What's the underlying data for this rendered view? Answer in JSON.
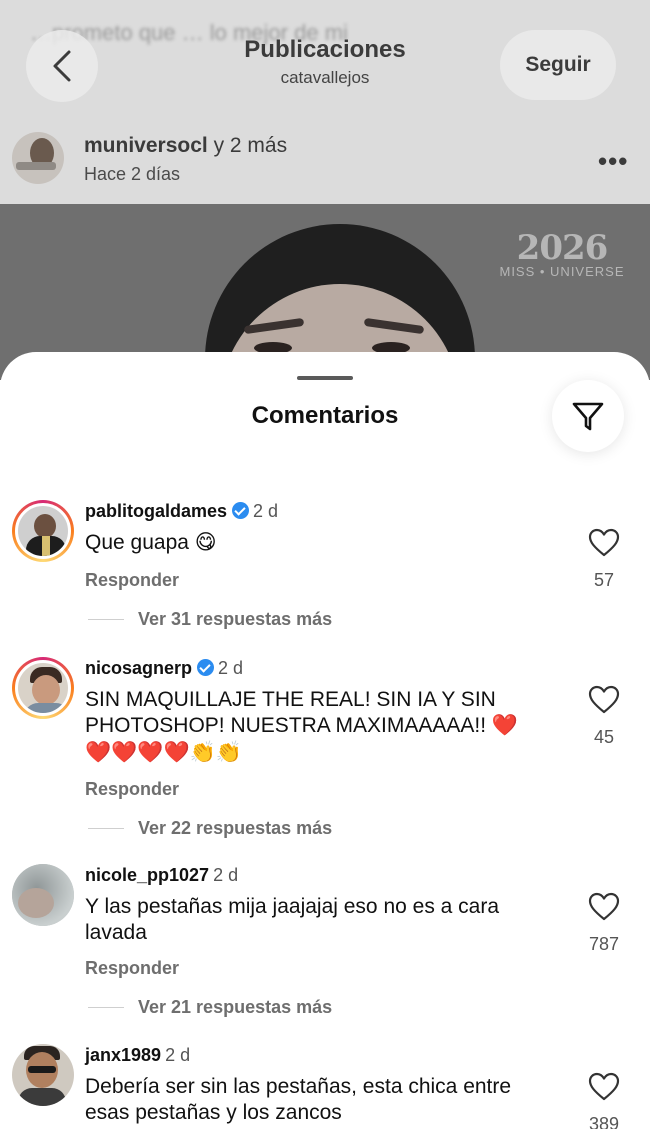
{
  "background": {
    "caption_blurred": "…prometo que … lo mejor de mi",
    "header": {
      "title": "Publicaciones",
      "subtitle": "catavallejos",
      "follow_label": "Seguir"
    },
    "post": {
      "author": "muniversocl",
      "author_suffix": "y 2 más",
      "time": "Hace 2 días",
      "more_label": "•••",
      "logo_year": "2026",
      "logo_name": "MISS • UNIVERSE"
    }
  },
  "sheet": {
    "title": "Comentarios"
  },
  "comments": [
    {
      "user": "pablitogaldames",
      "verified": true,
      "time": "2 d",
      "text": "Que guapa 😋",
      "reply_label": "Responder",
      "more_replies": "Ver 31 respuestas más",
      "likes": "57"
    },
    {
      "user": "nicosagnerp",
      "verified": true,
      "time": "2 d",
      "text": "SIN MAQUILLAJE THE REAL! SIN IA Y SIN PHOTOSHOP! NUESTRA MAXIMAAAAA!! ❤️",
      "text_line2": "❤️❤️❤️❤️👏👏",
      "reply_label": "Responder",
      "more_replies": "Ver 22 respuestas más",
      "likes": "45"
    },
    {
      "user": "nicole_pp1027",
      "verified": false,
      "time": "2 d",
      "text": "Y las pestañas mija jaajajaj eso no es a cara lavada",
      "reply_label": "Responder",
      "more_replies": "Ver 21 respuestas más",
      "likes": "787"
    },
    {
      "user": "janx1989",
      "verified": false,
      "time": "2 d",
      "text": "Debería ser sin las pestañas, esta chica entre esas pestañas y los zancos",
      "likes": "389"
    }
  ],
  "icons": {
    "back": "chevron-left-icon",
    "filter": "filter-icon",
    "like": "heart-outline-icon",
    "verified": "verified-badge-icon"
  },
  "colors": {
    "verified": "#2b8cf0",
    "story_ring_start": "#d62976",
    "story_ring_end": "#feda75",
    "secondary_text": "#6e6e6e"
  }
}
